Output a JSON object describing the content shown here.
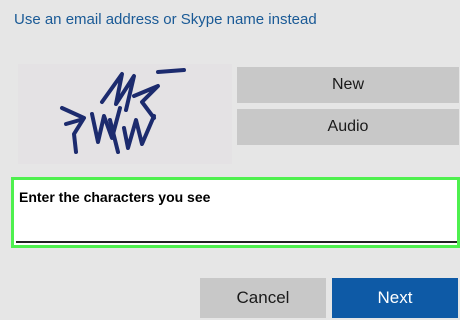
{
  "signin": {
    "alt_link": "Use an email address or Skype name instead"
  },
  "captcha": {
    "image_alt": "CAPTCHA image",
    "new_label": "New",
    "audio_label": "Audio"
  },
  "entry": {
    "placeholder": "Enter the characters you see",
    "value": ""
  },
  "actions": {
    "cancel_label": "Cancel",
    "next_label": "Next"
  },
  "colors": {
    "background": "#e6e6e6",
    "link": "#1a5a96",
    "button_gray": "#c8c8c8",
    "primary": "#0e5aa6",
    "focus_outline": "#4ef04e",
    "captcha_ink": "#1c2b6e"
  }
}
